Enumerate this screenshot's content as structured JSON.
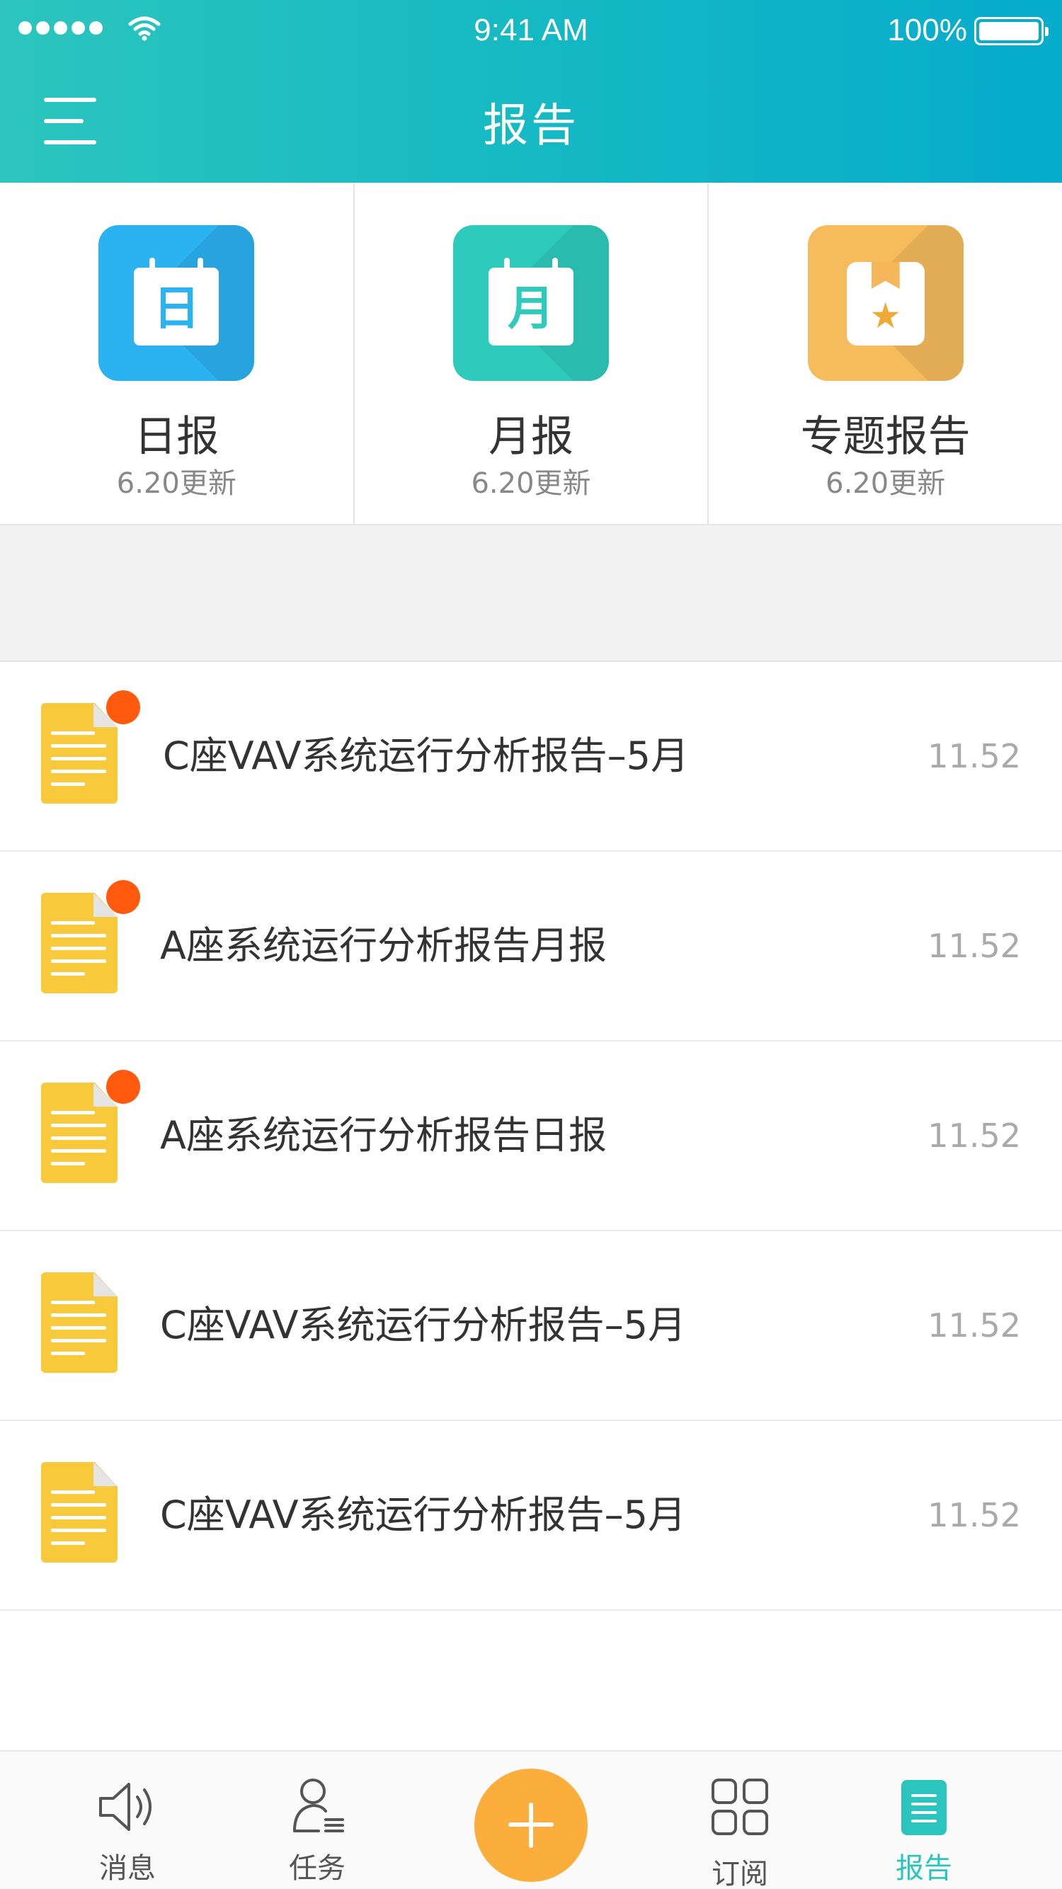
{
  "status_bar": {
    "time": "9:41 AM",
    "battery": "100%"
  },
  "header": {
    "title": "报告"
  },
  "categories": [
    {
      "name": "日报",
      "updated": "6.20更新",
      "glyph": "日",
      "icon": "calendar-icon",
      "color": "#2bb2f0"
    },
    {
      "name": "月报",
      "updated": "6.20更新",
      "glyph": "月",
      "icon": "calendar-icon",
      "color": "#2ecbbd"
    },
    {
      "name": "专题报告",
      "updated": "6.20更新",
      "icon": "bookmark-star-icon",
      "color": "#f6bc5c"
    }
  ],
  "reports": [
    {
      "title": "C座VAV系统运行分析报告–5月",
      "value": "11.52",
      "unread": true
    },
    {
      "title": "A座系统运行分析报告月报",
      "value": "11.52",
      "unread": true
    },
    {
      "title": "A座系统运行分析报告日报",
      "value": "11.52",
      "unread": true
    },
    {
      "title": "C座VAV系统运行分析报告–5月",
      "value": "11.52",
      "unread": false
    },
    {
      "title": "C座VAV系统运行分析报告–5月",
      "value": "11.52",
      "unread": false
    }
  ],
  "tabbar": {
    "items": [
      {
        "label": "消息",
        "icon": "speaker-icon"
      },
      {
        "label": "任务",
        "icon": "person-tasks-icon"
      },
      {
        "label": "",
        "icon": "plus-icon"
      },
      {
        "label": "订阅",
        "icon": "grid-icon"
      },
      {
        "label": "报告",
        "icon": "report-icon",
        "active": true
      }
    ]
  },
  "colors": {
    "accent": "#2cc5be",
    "header_end": "#07abcc",
    "fab": "#fbae3c",
    "doc": "#f7c93b",
    "badge": "#ff5a0d"
  }
}
